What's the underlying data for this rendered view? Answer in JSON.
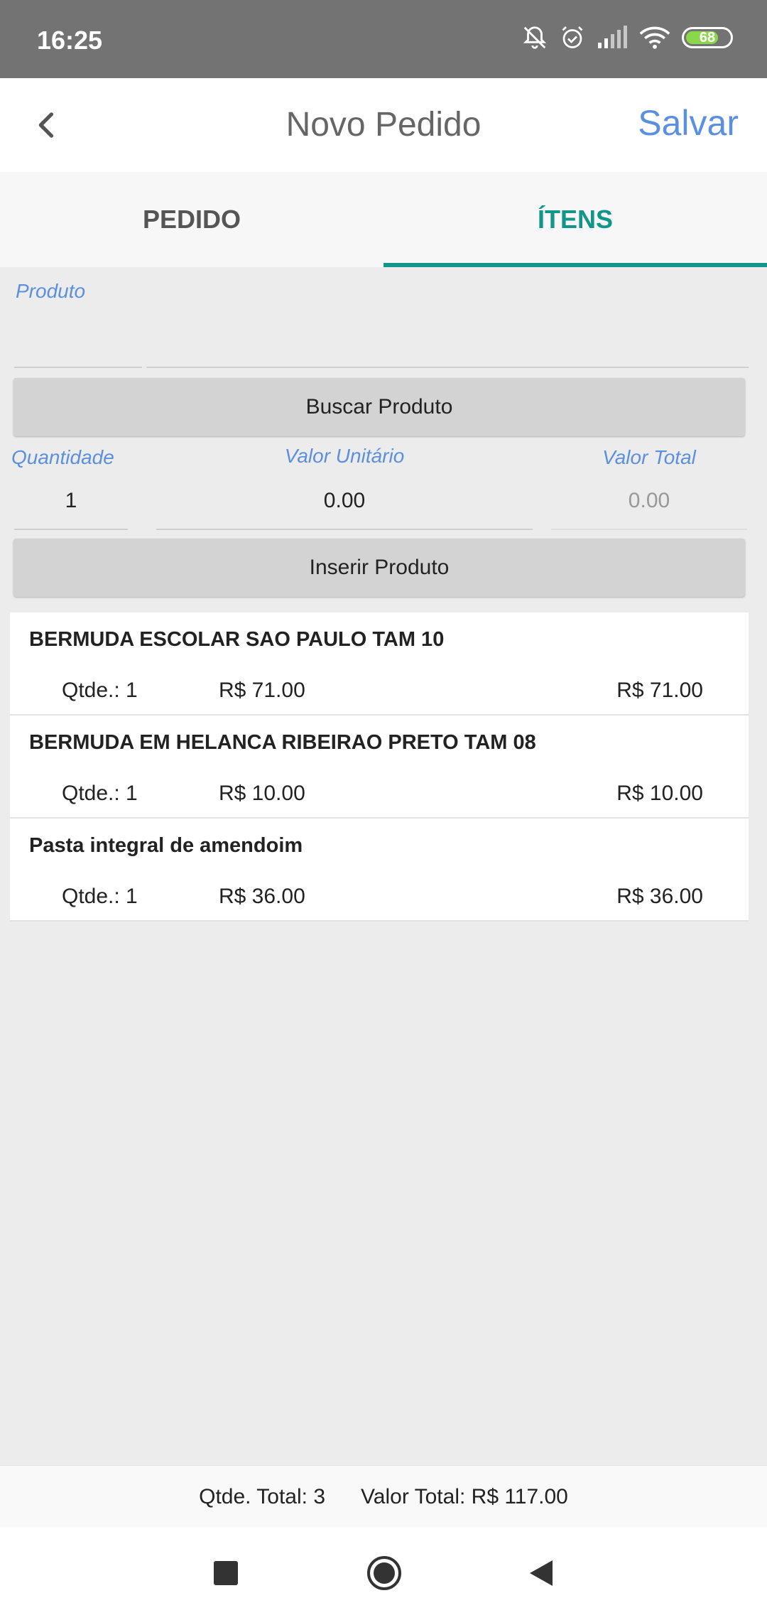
{
  "status_bar": {
    "time": "16:25",
    "battery": "68",
    "icons": [
      "notifications-off-icon",
      "alarm-icon",
      "signal-icon",
      "wifi-icon",
      "battery-icon"
    ]
  },
  "app_bar": {
    "title": "Novo Pedido",
    "save_label": "Salvar",
    "back_icon": "chevron-left-icon"
  },
  "tabs": [
    {
      "label": "PEDIDO",
      "active": false
    },
    {
      "label": "ÍTENS",
      "active": true
    }
  ],
  "form": {
    "product_label": "Produto",
    "product_value": "",
    "search_button": "Buscar Produto",
    "quantity_label": "Quantidade",
    "quantity_value": "1",
    "unit_price_label": "Valor Unitário",
    "unit_price_value": "0.00",
    "total_price_label": "Valor Total",
    "total_price_value": "0.00",
    "insert_button": "Inserir Produto"
  },
  "items": [
    {
      "name": "BERMUDA ESCOLAR SAO PAULO TAM 10",
      "qty": "Qtde.: 1",
      "unit": "R$ 71.00",
      "total": "R$ 71.00"
    },
    {
      "name": "BERMUDA EM HELANCA RIBEIRAO PRETO TAM 08",
      "qty": "Qtde.: 1",
      "unit": "R$ 10.00",
      "total": "R$ 10.00"
    },
    {
      "name": "Pasta integral de amendoim",
      "qty": "Qtde.: 1",
      "unit": "R$ 36.00",
      "total": "R$ 36.00"
    }
  ],
  "footer": {
    "total_qty": "Qtde. Total: 3",
    "total_value": "Valor Total: R$ 117.00"
  },
  "nav_bar": {
    "icons": [
      "recents-square-icon",
      "home-circle-icon",
      "back-triangle-icon"
    ]
  },
  "colors": {
    "accent": "#13968a",
    "link": "#5b8fe0",
    "status_bar": "#737373",
    "battery": "#8bd64a"
  }
}
